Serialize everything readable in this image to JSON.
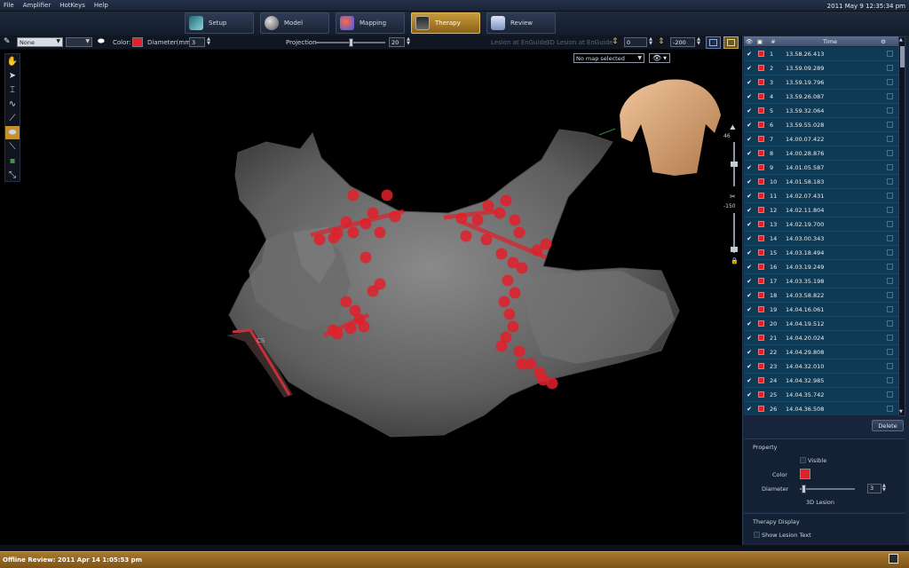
{
  "menu": {
    "items": [
      "File",
      "Amplifier",
      "HotKeys",
      "Help"
    ],
    "clock": "2011 May 9 12:35:34 pm"
  },
  "modes": [
    {
      "label": "Setup",
      "active": false
    },
    {
      "label": "Model",
      "active": false
    },
    {
      "label": "Mapping",
      "active": false
    },
    {
      "label": "Therapy",
      "active": true
    },
    {
      "label": "Review",
      "active": false
    }
  ],
  "toolbar": {
    "preset_value": "None",
    "color_label": "Color:",
    "color_value": "#e2202a",
    "diameter_label": "Diameter(mm):",
    "diameter_value": "3",
    "projection_label": "Projection",
    "projection_value": "20",
    "lesion_at_enguide": "Lesion at EnGuide",
    "lesion_3d_at_enguide": "3D Lesion at EnGuide",
    "val_a": "0",
    "val_b": "-200"
  },
  "viewport": {
    "map_select": "No map selected",
    "zoom_value": "46",
    "clip_value": "-150",
    "cs_label": "CS"
  },
  "lesion_table": {
    "time_header": "Time",
    "hash_header": "#",
    "rows": [
      {
        "n": "1",
        "time": "13.58.26.413"
      },
      {
        "n": "2",
        "time": "13.59.09.289"
      },
      {
        "n": "3",
        "time": "13.59.19.796"
      },
      {
        "n": "4",
        "time": "13.59.26.087"
      },
      {
        "n": "5",
        "time": "13.59.32.064"
      },
      {
        "n": "6",
        "time": "13.59.55.028"
      },
      {
        "n": "7",
        "time": "14.00.07.422"
      },
      {
        "n": "8",
        "time": "14.00.28.876"
      },
      {
        "n": "9",
        "time": "14.01.05.587"
      },
      {
        "n": "10",
        "time": "14.01.58.183"
      },
      {
        "n": "11",
        "time": "14.02.07.431"
      },
      {
        "n": "12",
        "time": "14.02.11.804"
      },
      {
        "n": "13",
        "time": "14.02.19.700"
      },
      {
        "n": "14",
        "time": "14.03.00.343"
      },
      {
        "n": "15",
        "time": "14.03.18.494"
      },
      {
        "n": "16",
        "time": "14.03.19.249"
      },
      {
        "n": "17",
        "time": "14.03.35.198"
      },
      {
        "n": "18",
        "time": "14.03.58.822"
      },
      {
        "n": "19",
        "time": "14.04.16.061"
      },
      {
        "n": "20",
        "time": "14.04.19.512"
      },
      {
        "n": "21",
        "time": "14.04.20.024"
      },
      {
        "n": "22",
        "time": "14.04.29.808"
      },
      {
        "n": "23",
        "time": "14.04.32.010"
      },
      {
        "n": "24",
        "time": "14.04.32.985"
      },
      {
        "n": "25",
        "time": "14.04.35.742"
      },
      {
        "n": "26",
        "time": "14.04.36.508"
      }
    ],
    "delete_label": "Delete"
  },
  "property": {
    "title": "Property",
    "visible_label": "Visible",
    "color_label": "Color",
    "diameter_label": "Diameter",
    "diameter_value": "3",
    "lesion_3d_label": "3D Lesion"
  },
  "therapy_display": {
    "title": "Therapy Display",
    "show_lesion_text": "Show Lesion Text"
  },
  "status": {
    "text": "Offline Review: 2011 Apr 14 1:05:53 pm"
  }
}
